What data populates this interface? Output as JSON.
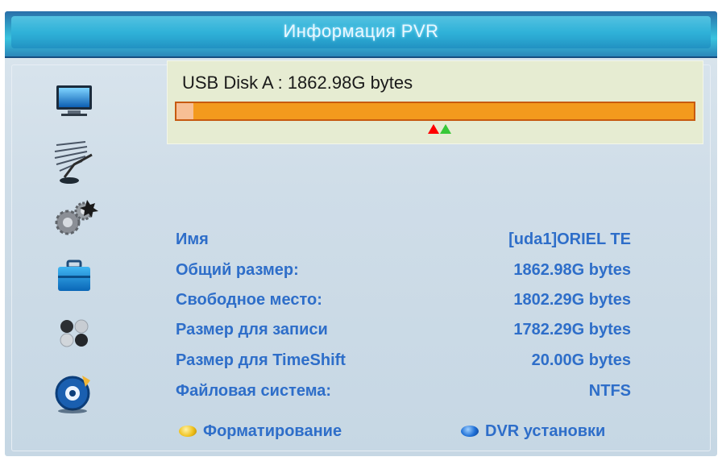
{
  "header": {
    "title": "Информация PVR"
  },
  "sidebar": {
    "icons": [
      {
        "name": "tv-icon"
      },
      {
        "name": "satellite-dish-icon"
      },
      {
        "name": "settings-gears-icon"
      },
      {
        "name": "toolbox-icon"
      },
      {
        "name": "balls-icon"
      },
      {
        "name": "media-disc-icon"
      }
    ]
  },
  "disk": {
    "title": "USB Disk A : 1862.98G bytes",
    "used_fraction": 0.032
  },
  "info": {
    "rows": [
      {
        "label": "Имя",
        "value": "[uda1]ORIEL TE"
      },
      {
        "label": "Общий размер:",
        "value": "1862.98G bytes"
      },
      {
        "label": "Свободное место:",
        "value": "1802.29G bytes"
      },
      {
        "label": "Размер для записи",
        "value": "1782.29G bytes"
      },
      {
        "label": "Размер для TimeShift",
        "value": "20.00G bytes"
      },
      {
        "label": "Файловая система:",
        "value": "NTFS"
      }
    ]
  },
  "footer": {
    "format_label": "Форматирование",
    "dvr_label": "DVR установки",
    "colors": {
      "format": "#f0c21e",
      "dvr": "#1e6fd6"
    }
  }
}
